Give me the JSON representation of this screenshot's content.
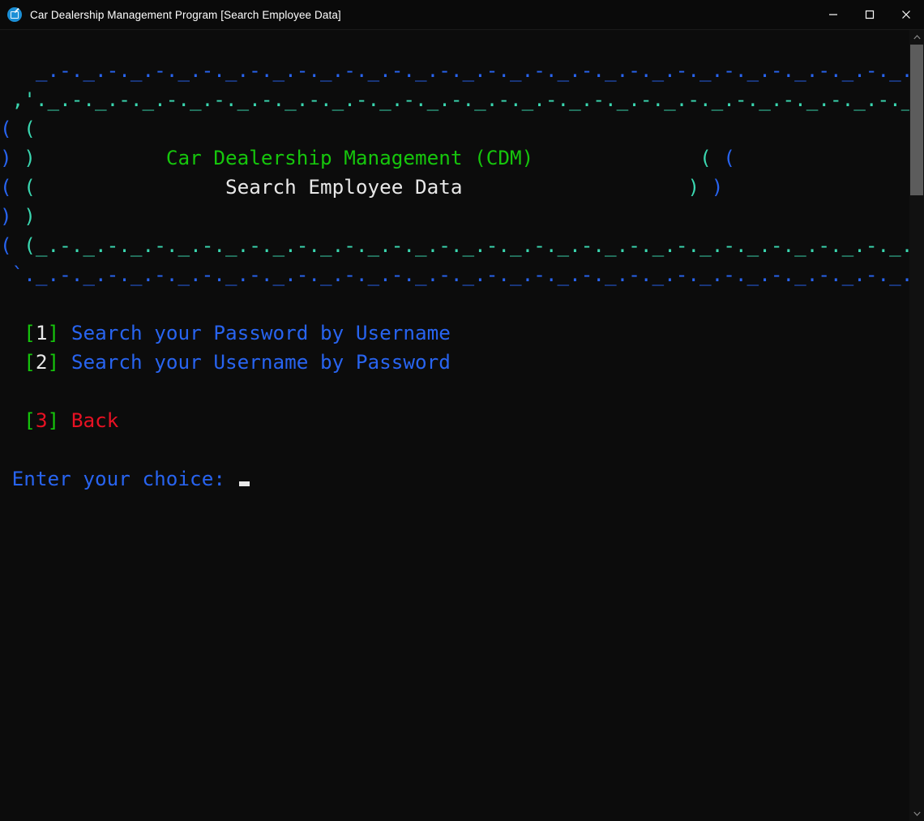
{
  "window": {
    "title": "Car Dealership Management Program [Search Employee Data]",
    "icon": "app-icon",
    "controls": {
      "minimize_label": "Minimize",
      "maximize_label": "Maximize",
      "close_label": "Close"
    }
  },
  "colors": {
    "background": "#0c0c0c",
    "border_outer": "#2864f0",
    "border_inner": "#3ad7b0",
    "app_title": "#16c60c",
    "screen_title": "#e8e8e8",
    "menu_text": "#2864f0",
    "bracket": "#16c60c",
    "number": "#e8e8e8",
    "back_option": "#e81123"
  },
  "banner": {
    "top_outer": "   _.-._.-._.-._.-._.-._.-._.-._.-._.-._.-._.-._.-._.-._.-._.-._.-._.-._.-._.-._",
    "top_inner": " ,'._.-._.-._.-._.-._.-._.-._.-._.-._.-._.-._.-._.-._.-._.-._.-._.-._.-._.-._.-.`.",
    "side_rows": [
      {
        "left_outer": "(",
        "left_inner": "(",
        "right_inner": ")",
        "right_outer": ")",
        "center": ""
      },
      {
        "left_outer": ")",
        "left_inner": ")",
        "right_inner": "(",
        "right_outer": "(",
        "center": "Car Dealership Management (CDM)"
      },
      {
        "left_outer": "(",
        "left_inner": "(",
        "right_inner": ")",
        "right_outer": ")",
        "center": "Search Employee Data"
      },
      {
        "left_outer": ")",
        "left_inner": ")",
        "right_inner": "(",
        "right_outer": "(",
        "center": ""
      }
    ],
    "bottom_inner": "( (_.-._.-._.-._.-._.-._.-._.-._.-._.-._.-._.-._.-._.-._.-._.-._.-._.-._.-._.-._.-._) )",
    "bottom_outer": " `._.-._.-._.-._.-._.-._.-._.-._.-._.-._.-._.-._.-._.-._.-._.-._.-._.-._.-._.-._.-.'",
    "app_title": "Car Dealership Management (CDM)",
    "screen_title": "Search Employee Data"
  },
  "menu": {
    "options": [
      {
        "bracket_open": "[",
        "key": "1",
        "bracket_close": "]",
        "label": "Search your Password by Username",
        "style": "normal"
      },
      {
        "bracket_open": "[",
        "key": "2",
        "bracket_close": "]",
        "label": "Search your Username by Password",
        "style": "normal"
      },
      {
        "bracket_open": "[",
        "key": "3",
        "bracket_close": "]",
        "label": "Back",
        "style": "back"
      }
    ]
  },
  "prompt": {
    "label": "Enter your choice:",
    "value": "",
    "cursor": "block"
  },
  "scrollbar": {
    "up_arrow": "scroll-up-icon",
    "down_arrow": "scroll-down-icon",
    "thumb_position": "top"
  }
}
